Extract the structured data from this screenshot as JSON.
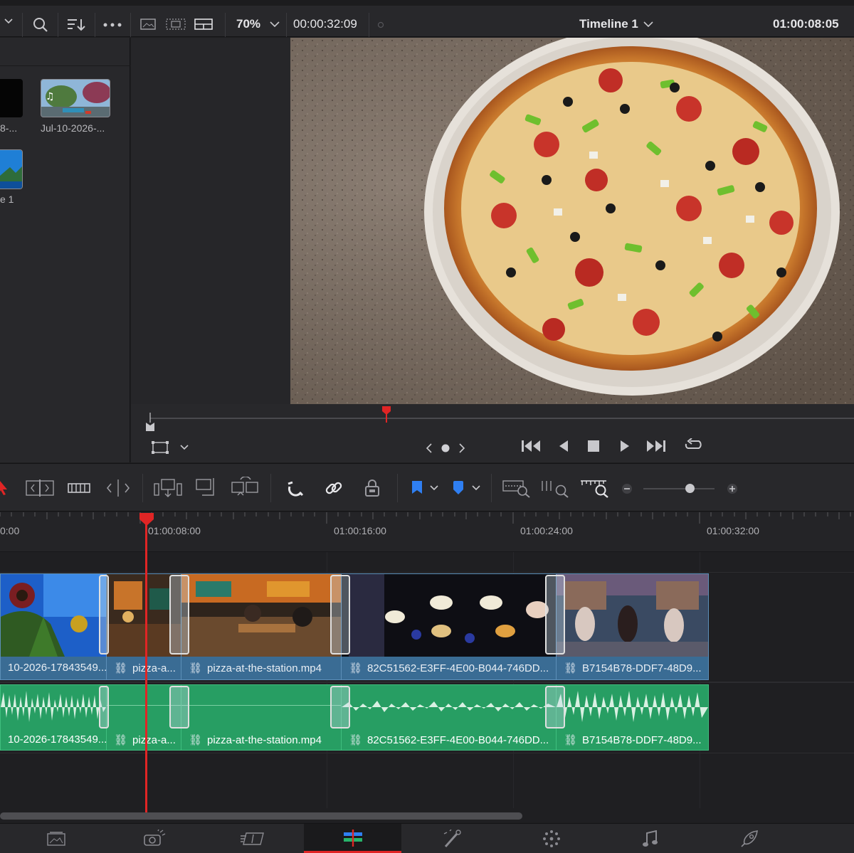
{
  "topbar": {
    "zoom": "70%",
    "source_timecode": "00:00:32:09",
    "timeline_name": "Timeline 1",
    "record_timecode": "01:00:08:05"
  },
  "mediapool": {
    "items": [
      {
        "label": "8-..."
      },
      {
        "label": "Jul-10-2026-..."
      },
      {
        "label": "e 1"
      }
    ]
  },
  "timeline": {
    "ruler": [
      "0:00",
      "01:00:08:00",
      "01:00:16:00",
      "01:00:24:00",
      "01:00:32:00"
    ],
    "video_clips": [
      {
        "name": "10-2026-17843549..."
      },
      {
        "name": "pizza-a..."
      },
      {
        "name": "pizza-at-the-station.mp4"
      },
      {
        "name": "82C51562-E3FF-4E00-B044-746DD..."
      },
      {
        "name": "B7154B78-DDF7-48D9..."
      }
    ],
    "audio_clips": [
      {
        "name": "10-2026-17843549..."
      },
      {
        "name": "pizza-a..."
      },
      {
        "name": "pizza-at-the-station.mp4"
      },
      {
        "name": "82C51562-E3FF-4E00-B044-746DD..."
      },
      {
        "name": "B7154B78-DDF7-48D9..."
      }
    ]
  },
  "colors": {
    "video_clip": "#3a6c94",
    "audio_clip": "#279e63",
    "playhead": "#e02525",
    "accent_blue": "#2f7ff2"
  },
  "icons": [
    "search-icon",
    "sort-icon",
    "more-icon",
    "zoom-dropdown-icon",
    "selection-arrow-icon",
    "trim-icon",
    "blade-icon",
    "snap-magnet-icon",
    "link-icon",
    "lock-icon",
    "flag-icon",
    "marker-icon",
    "play-icon",
    "stop-icon",
    "loop-icon",
    "cut-page-icon",
    "edit-page-icon",
    "fusion-page-icon",
    "color-page-icon",
    "fairlight-page-icon",
    "deliver-page-icon"
  ]
}
